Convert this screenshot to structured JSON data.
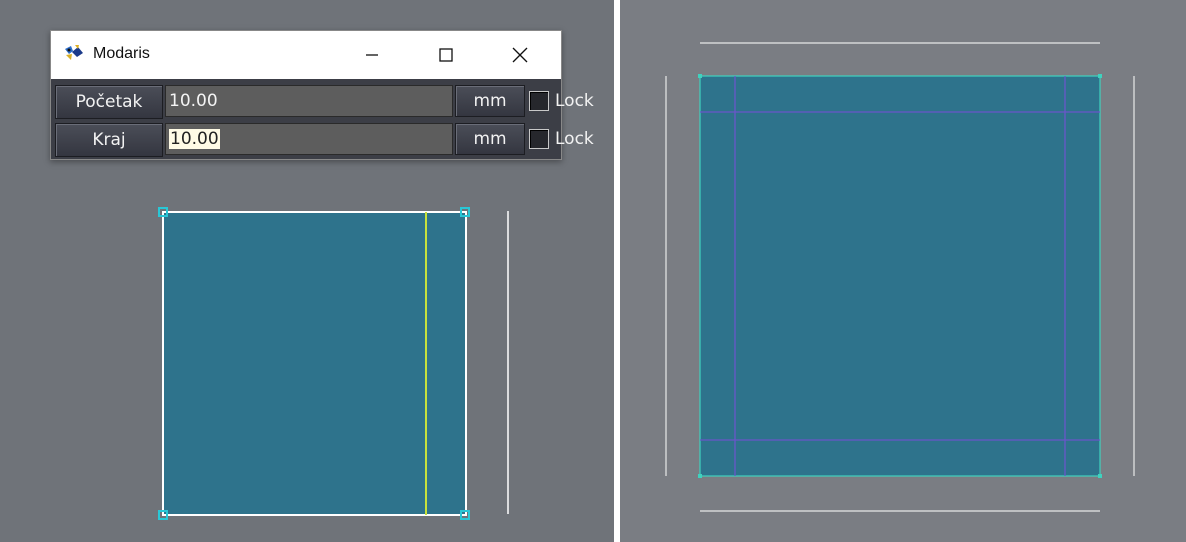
{
  "window": {
    "title": "Modaris",
    "icon": "modaris-app-icon"
  },
  "rows": [
    {
      "label": "Početak",
      "value": "10.00",
      "unit": "mm",
      "lock_label": "Lock",
      "locked": false,
      "selected": false
    },
    {
      "label": "Kraj",
      "value": "10.00",
      "unit": "mm",
      "lock_label": "Lock",
      "locked": false,
      "selected": true
    }
  ],
  "colors": {
    "canvas_left": "#6f7379",
    "canvas_right": "#7a7d83",
    "piece_fill": "#2e738c",
    "outline": "#ffffff",
    "handle": "#29c7d6",
    "selected_line": "#c8e23c",
    "seam_line": "#6a56c9",
    "right_outline": "#3fd2bf"
  },
  "icons": [
    "minimize-icon",
    "maximize-icon",
    "close-icon",
    "checkbox-icon"
  ]
}
